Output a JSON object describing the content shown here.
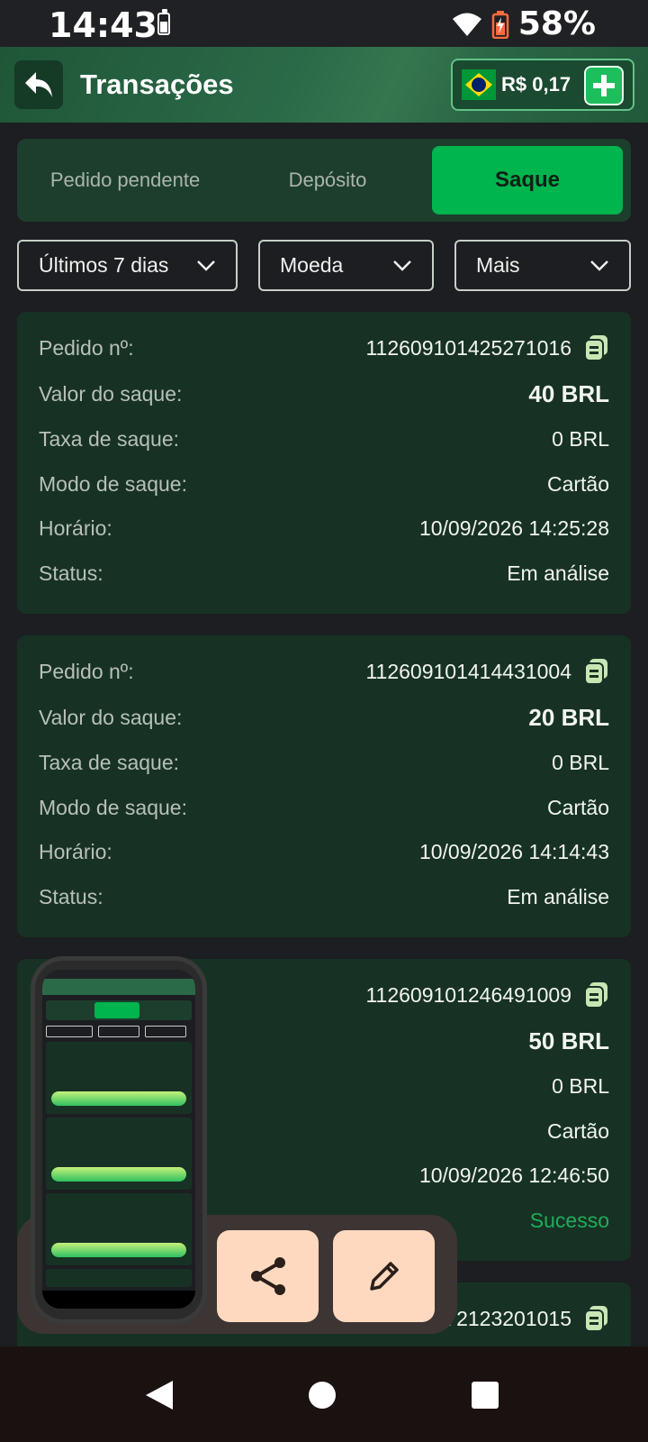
{
  "status_bar": {
    "time": "14:43",
    "battery_pct": "58%"
  },
  "header": {
    "title": "Transações",
    "balance": "R$ 0,17"
  },
  "tabs": [
    {
      "label": "Pedido pendente",
      "active": false
    },
    {
      "label": "Depósito",
      "active": false
    },
    {
      "label": "Saque",
      "active": true
    }
  ],
  "filters": [
    {
      "label": "Últimos 7 dias"
    },
    {
      "label": "Moeda"
    },
    {
      "label": "Mais"
    }
  ],
  "labels": {
    "order": "Pedido nº:",
    "amount": "Valor do saque:",
    "fee": "Taxa de saque:",
    "mode": "Modo de saque:",
    "time": "Horário:",
    "status": "Status:"
  },
  "transactions": [
    {
      "order": "112609101425271016",
      "amount": "40 BRL",
      "fee": "0 BRL",
      "mode": "Cartão",
      "time": "10/09/2026 14:25:28",
      "status": "Em análise"
    },
    {
      "order": "112609101414431004",
      "amount": "20 BRL",
      "fee": "0 BRL",
      "mode": "Cartão",
      "time": "10/09/2026 14:14:43",
      "status": "Em análise"
    },
    {
      "order": "112609101246491009",
      "amount": "50 BRL",
      "fee": "0 BRL",
      "mode": "Cartão",
      "time": "10/09/2026 12:46:50",
      "status": "Sucesso"
    },
    {
      "order_partial": "72123201015"
    }
  ],
  "colors": {
    "accent": "#00b44e",
    "success": "#1fad5a",
    "card": "#173224",
    "background": "#1c1e21"
  },
  "icons": {
    "back": "back-arrow-icon",
    "copy": "copy-icon",
    "share": "share-icon",
    "edit": "pencil-icon"
  }
}
